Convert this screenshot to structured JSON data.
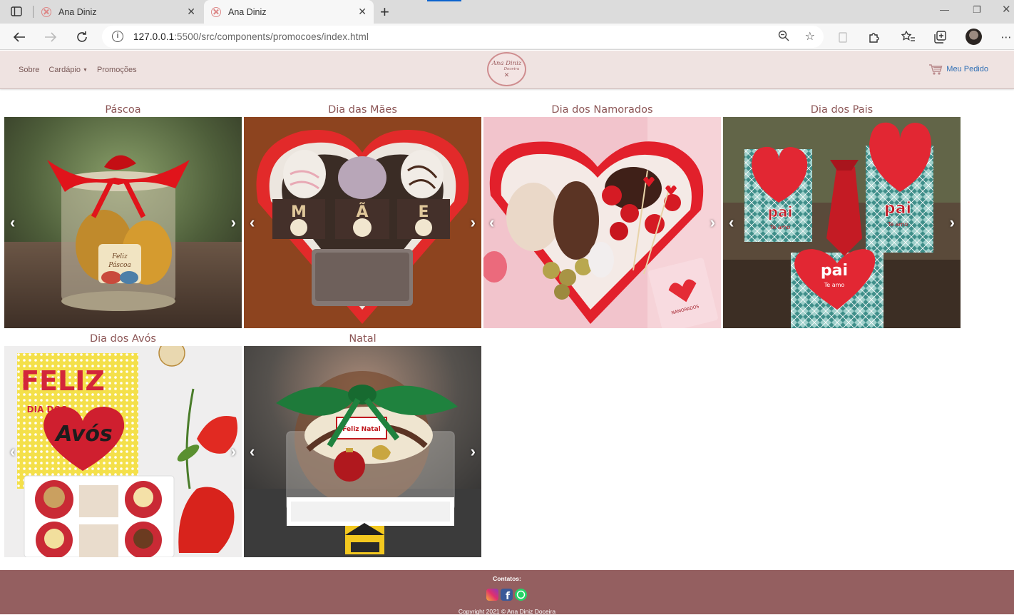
{
  "browser": {
    "tabs": [
      {
        "title": "Ana Diniz",
        "active": false
      },
      {
        "title": "Ana Diniz",
        "active": true
      }
    ],
    "url_host": "127.0.0.1",
    "url_rest": ":5500/src/components/promocoes/index.html",
    "icons": [
      "back-icon",
      "forward-icon",
      "reload-icon",
      "info-icon",
      "zoom-icon",
      "add-favorite-icon",
      "extensions-icon",
      "favorites-icon",
      "collections-icon",
      "profile-avatar"
    ]
  },
  "header": {
    "nav": {
      "about": "Sobre",
      "menu": "Cardápio",
      "promotions": "Promoções"
    },
    "logo": {
      "line1": "Ana Diniz",
      "line2": "Doceira"
    },
    "order_label": "Meu Pedido"
  },
  "promotions": [
    {
      "title": "Páscoa"
    },
    {
      "title": "Dia das Mães"
    },
    {
      "title": "Dia dos Namorados"
    },
    {
      "title": "Dia dos Pais"
    },
    {
      "title": "Dia dos Avós"
    },
    {
      "title": "Natal"
    }
  ],
  "carousel": {
    "prev": "‹",
    "next": "›"
  },
  "photo_text": {
    "pascoa_label_1": "Feliz",
    "pascoa_label_2": "Páscoa",
    "maes_letters": [
      "M",
      "Ã",
      "E"
    ],
    "namorados_card": "NAMORADOS",
    "pais_word": "pai",
    "pais_sub": "Te amo",
    "avos_1": "FELIZ",
    "avos_2": "DIA DOS",
    "avos_3": "Avós",
    "natal_label": "Feliz Natal"
  },
  "footer": {
    "contacts": "Contatos:",
    "copyright": "Copyright 2021 © Ana Diniz Doceira"
  },
  "colors": {
    "header_bg": "#efe3e1",
    "brand_text": "#8c5656",
    "footer_bg": "#945f60",
    "link_blue": "#2f6fb5"
  }
}
